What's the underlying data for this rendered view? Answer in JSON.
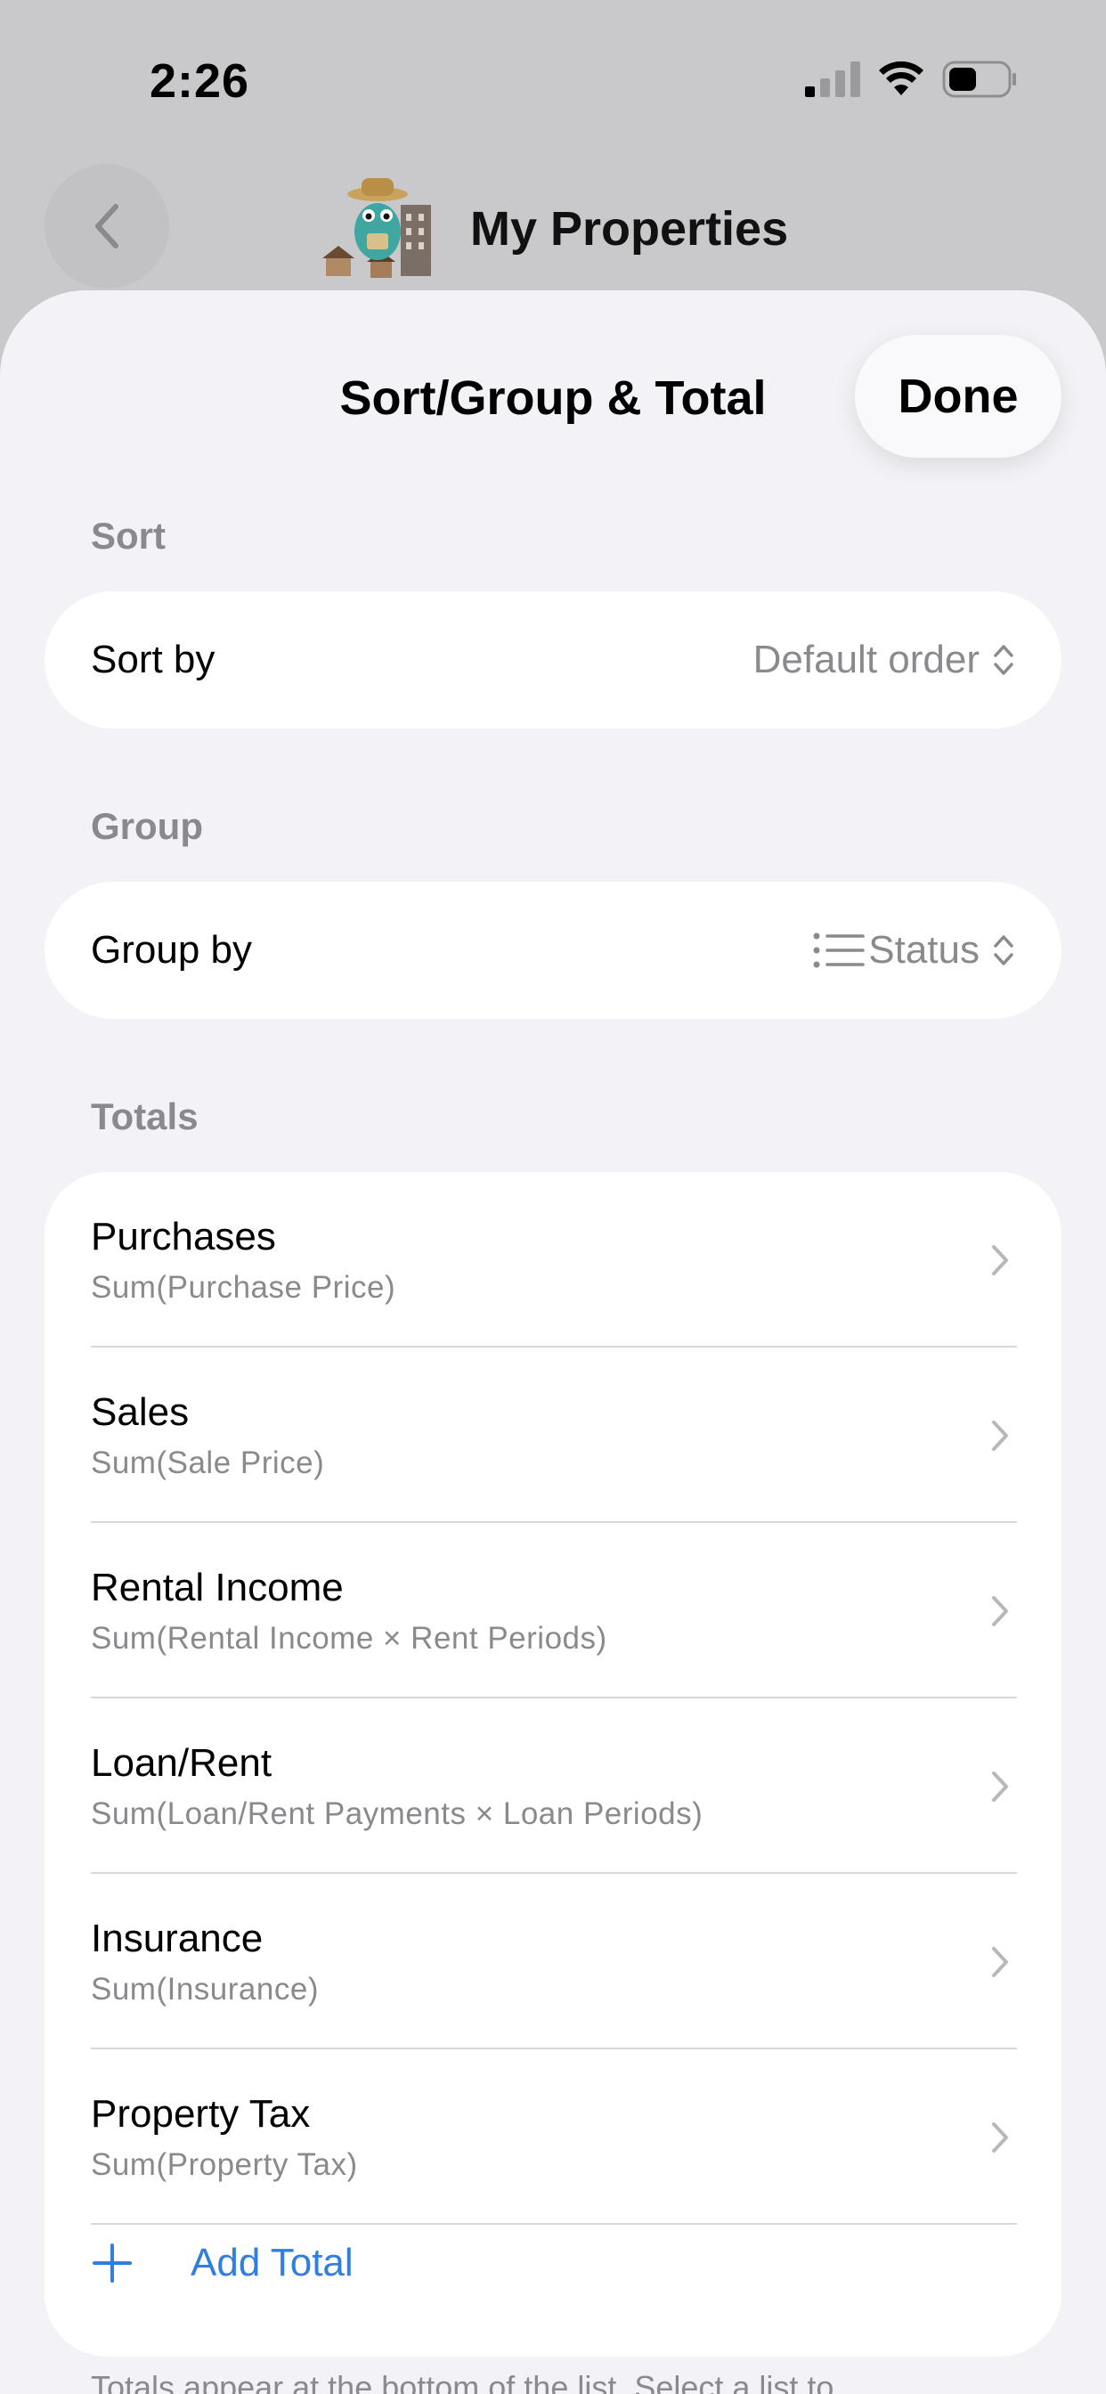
{
  "status_bar": {
    "time": "2:26"
  },
  "nav": {
    "title": "My Properties"
  },
  "sheet": {
    "title": "Sort/Group & Total",
    "done_label": "Done",
    "sort": {
      "section": "Sort",
      "label": "Sort by",
      "value": "Default order"
    },
    "group": {
      "section": "Group",
      "label": "Group by",
      "value": "Status"
    },
    "totals": {
      "section": "Totals",
      "items": [
        {
          "title": "Purchases",
          "formula": "Sum(Purchase Price)"
        },
        {
          "title": "Sales",
          "formula": "Sum(Sale Price)"
        },
        {
          "title": "Rental Income",
          "formula": "Sum(Rental Income × Rent Periods)"
        },
        {
          "title": "Loan/Rent",
          "formula": "Sum(Loan/Rent Payments × Loan Periods)"
        },
        {
          "title": "Insurance",
          "formula": "Sum(Insurance)"
        },
        {
          "title": "Property Tax",
          "formula": "Sum(Property Tax)"
        }
      ],
      "add_label": "Add Total"
    },
    "footer_note": "Totals appear at the bottom of the list. Select a list to"
  },
  "colors": {
    "accent": "#2f7ee0",
    "secondary_text": "#8a8a8e",
    "sheet_bg": "#f2f2f7"
  },
  "icons": [
    "signal-icon",
    "wifi-icon",
    "battery-icon",
    "back-chevron-icon",
    "app-logo",
    "updown-chevron-icon",
    "list-icon",
    "chevron-right-icon",
    "plus-icon"
  ]
}
